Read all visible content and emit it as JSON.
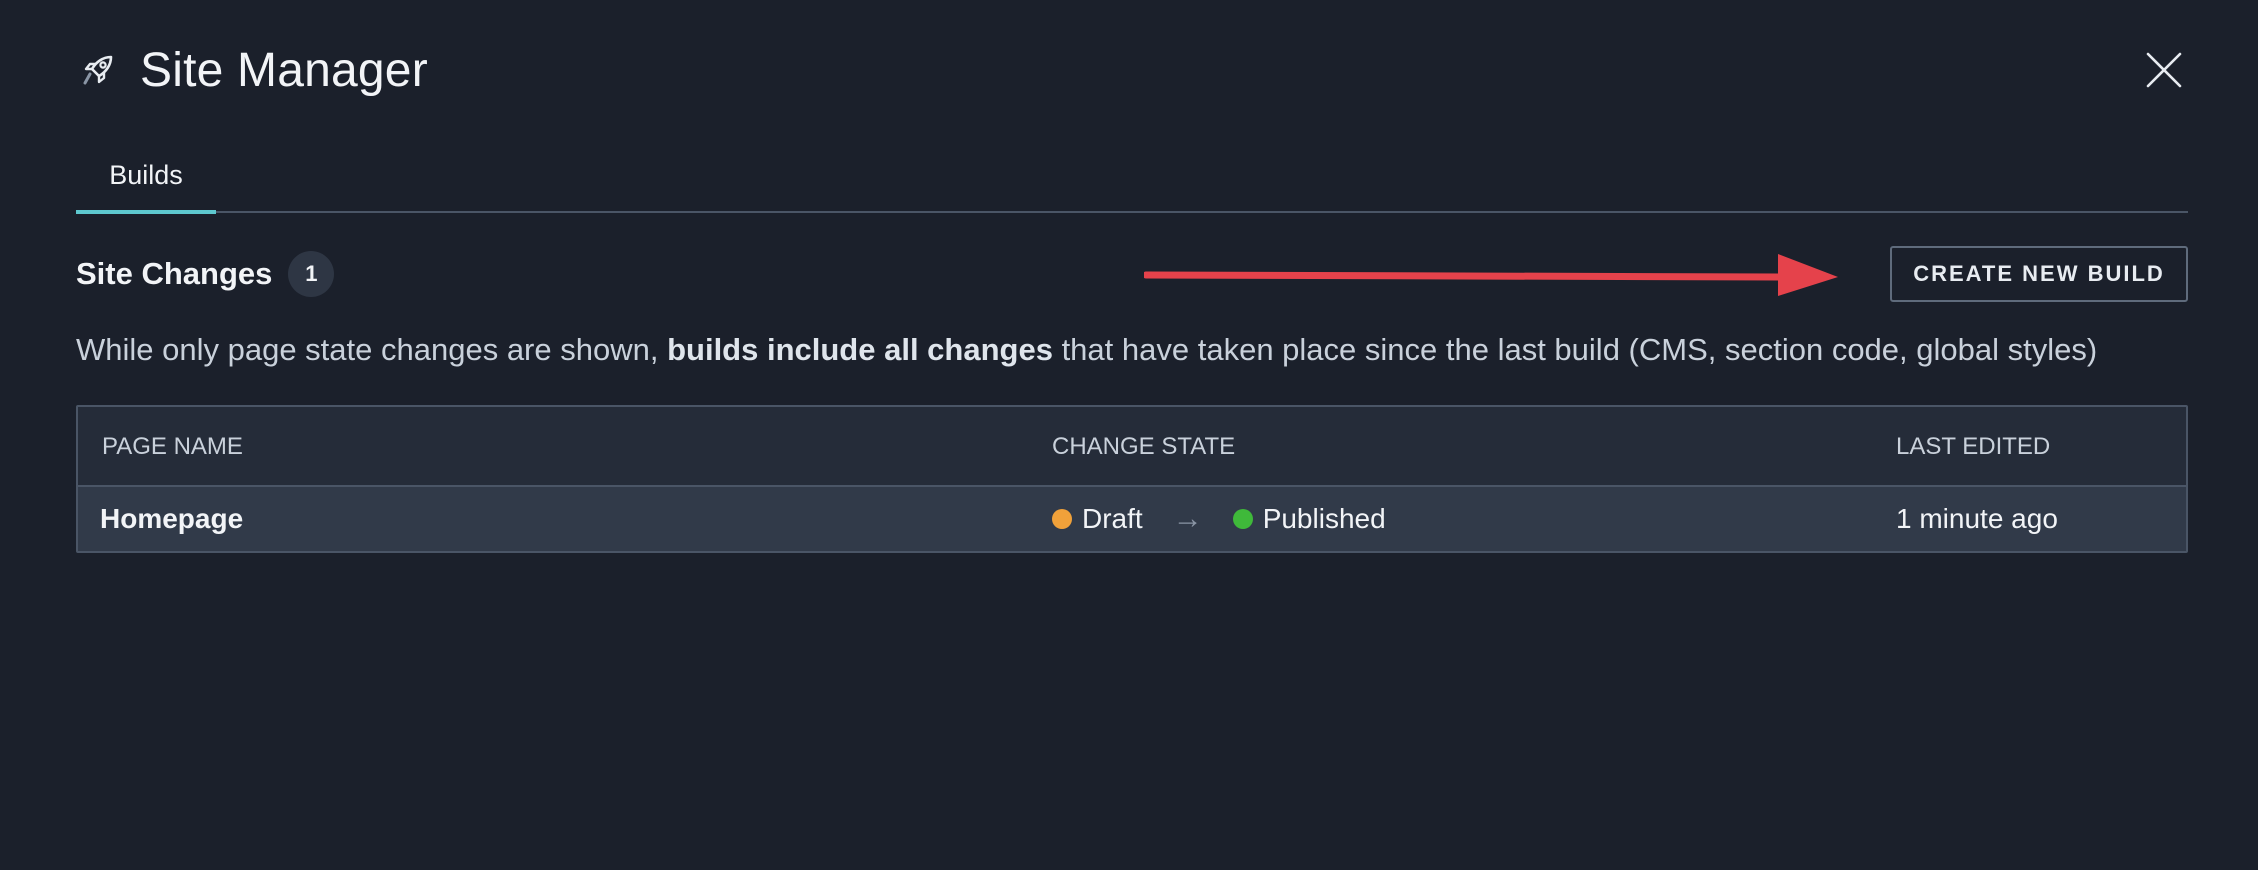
{
  "header": {
    "title": "Site Manager",
    "icon": "rocket-icon",
    "close_icon": "close-icon"
  },
  "tabs": [
    {
      "label": "Builds",
      "active": true
    }
  ],
  "section": {
    "title": "Site Changes",
    "count": "1",
    "create_button_label": "CREATE NEW BUILD",
    "description_pre": "While only page state changes are shown, ",
    "description_bold": "builds include all changes",
    "description_post": " that have taken place since the last build (CMS, section code, global styles)"
  },
  "table": {
    "columns": [
      "PAGE NAME",
      "CHANGE STATE",
      "LAST EDITED"
    ],
    "rows": [
      {
        "page_name": "Homepage",
        "from_state": "Draft",
        "to_state": "Published",
        "state_arrow": "→",
        "last_edited": "1 minute ago"
      }
    ]
  },
  "colors": {
    "background": "#1b202b",
    "accent": "#5ec8cf",
    "draft": "#f0a13a",
    "published": "#3fb93a",
    "annotation_arrow": "#e5424b"
  }
}
